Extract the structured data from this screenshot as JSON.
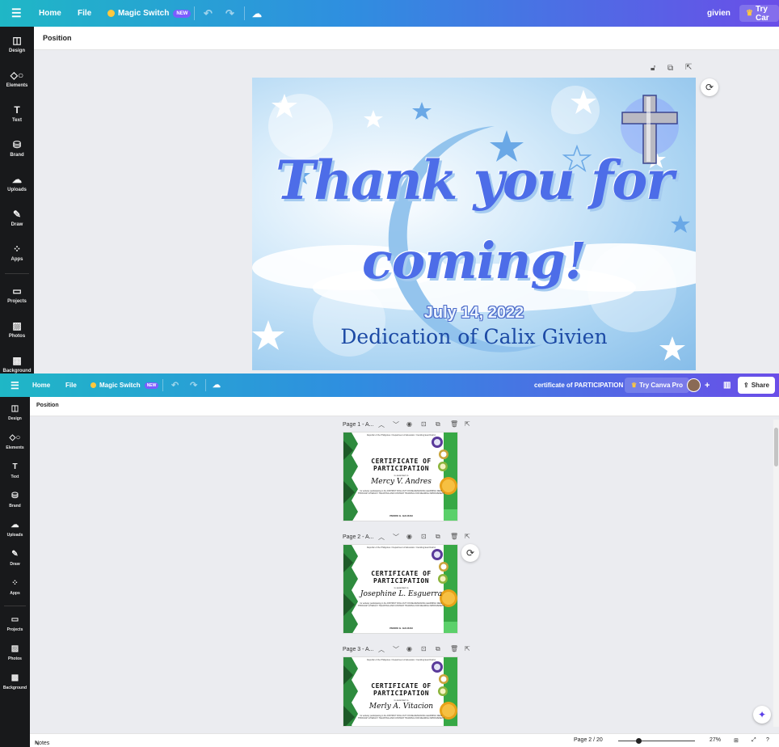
{
  "top": {
    "topbar": {
      "menu_icon": "hamburger-icon",
      "home": "Home",
      "file": "File",
      "magic_switch": "Magic Switch",
      "new_badge": "NEW",
      "user": "givien",
      "try_label": "Try Car"
    },
    "context": {
      "position": "Position"
    },
    "sidebar": [
      {
        "icon": "layout-icon",
        "label": "Design"
      },
      {
        "icon": "shapes-icon",
        "label": "Elements"
      },
      {
        "icon": "text-icon",
        "label": "Text"
      },
      {
        "icon": "brand-icon",
        "label": "Brand"
      },
      {
        "icon": "upload-icon",
        "label": "Uploads"
      },
      {
        "icon": "draw-icon",
        "label": "Draw"
      },
      {
        "icon": "apps-icon",
        "label": "Apps"
      },
      {
        "icon": "folder-icon",
        "label": "Projects"
      },
      {
        "icon": "photo-icon",
        "label": "Photos"
      },
      {
        "icon": "background-icon",
        "label": "Background"
      }
    ],
    "design": {
      "line1": "Thank you for",
      "line2": "coming!",
      "date": "July 14, 2022",
      "event": "Dedication of Calix Givien"
    }
  },
  "bottom": {
    "topbar": {
      "home": "Home",
      "file": "File",
      "magic_switch": "Magic Switch",
      "new_badge": "NEW",
      "doc_title": "certificate of PARTICIPATION",
      "try_pro": "Try Canva Pro",
      "share": "Share"
    },
    "context": {
      "position": "Position"
    },
    "sidebar": [
      {
        "icon": "layout-icon",
        "label": "Design"
      },
      {
        "icon": "shapes-icon",
        "label": "Elements"
      },
      {
        "icon": "text-icon",
        "label": "Text"
      },
      {
        "icon": "brand-icon",
        "label": "Brand"
      },
      {
        "icon": "upload-icon",
        "label": "Uploads"
      },
      {
        "icon": "draw-icon",
        "label": "Draw"
      },
      {
        "icon": "apps-icon",
        "label": "Apps"
      },
      {
        "icon": "folder-icon",
        "label": "Projects"
      },
      {
        "icon": "photo-icon",
        "label": "Photos"
      },
      {
        "icon": "background-icon",
        "label": "Background"
      }
    ],
    "pages": [
      {
        "label": "Page 1 - A...",
        "name": "Mercy V. Andres"
      },
      {
        "label": "Page 2 - A...",
        "name": "Josephine L. Esguerra"
      },
      {
        "label": "Page 3 - A...",
        "name": "Merly A. Vitacion"
      }
    ],
    "certificate": {
      "header": "Republic of the Philippines / Department of Education / Camiling East District",
      "title_line1": "CERTIFICATE OF",
      "title_line2": "PARTICIPATION",
      "awarded": "is awarded to",
      "body": "for actively participating in the DISTRICT ROLLOUT ON RE-DESIGNING LEARNING WELL THROUGH LITERACY TEACHING AND CONTENT TRAINING FOR READING IMPROVEMENT",
      "signatory": "PEDRO G. GAUZAN"
    },
    "bottombar": {
      "notes": "Notes",
      "page_indicator": "Page 2 / 20",
      "zoom": "27%"
    }
  }
}
